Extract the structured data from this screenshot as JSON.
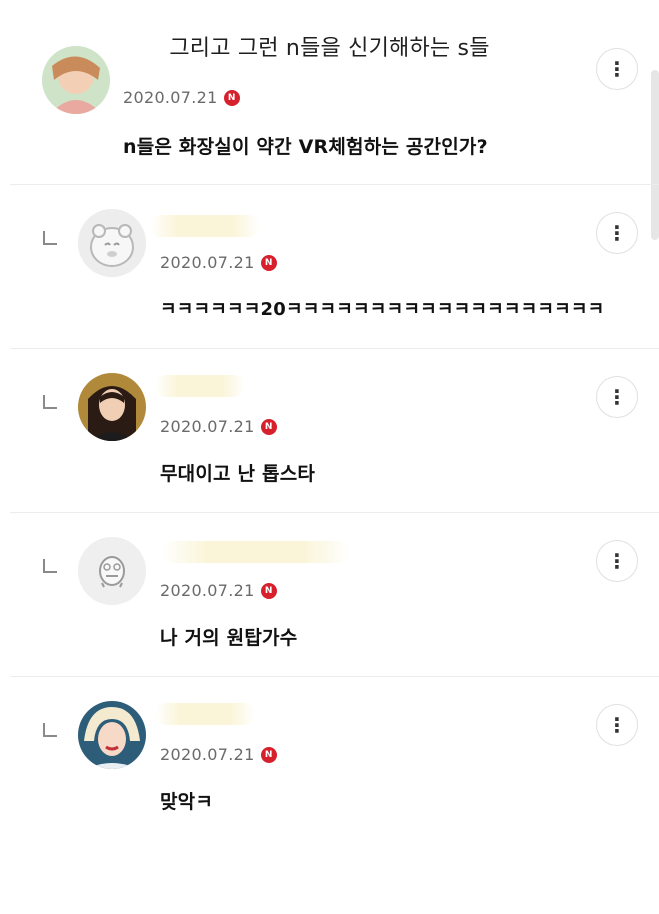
{
  "caption": "그리고 그런 n들을 신기해하는 s들",
  "badge_letter": "N",
  "more_icon": "⋮",
  "comments": [
    {
      "date": "2020.07.21",
      "text": "n들은 화장실이 약간 VR체험하는 공간인가?"
    },
    {
      "date": "2020.07.21",
      "text": "ㅋㅋㅋㅋㅋㅋ20ㅋㅋㅋㅋㅋㅋㅋㅋㅋㅋㅋㅋㅋㅋㅋㅋㅋㅋㅋ"
    },
    {
      "date": "2020.07.21",
      "text": "무대이고 난 톱스타"
    },
    {
      "date": "2020.07.21",
      "text": "나 거의 원탑가수"
    },
    {
      "date": "2020.07.21",
      "text": "맞악ㅋ"
    }
  ],
  "colors": {
    "badge": "#d6202c",
    "divider": "#ececec",
    "date": "#6a6a6a"
  }
}
